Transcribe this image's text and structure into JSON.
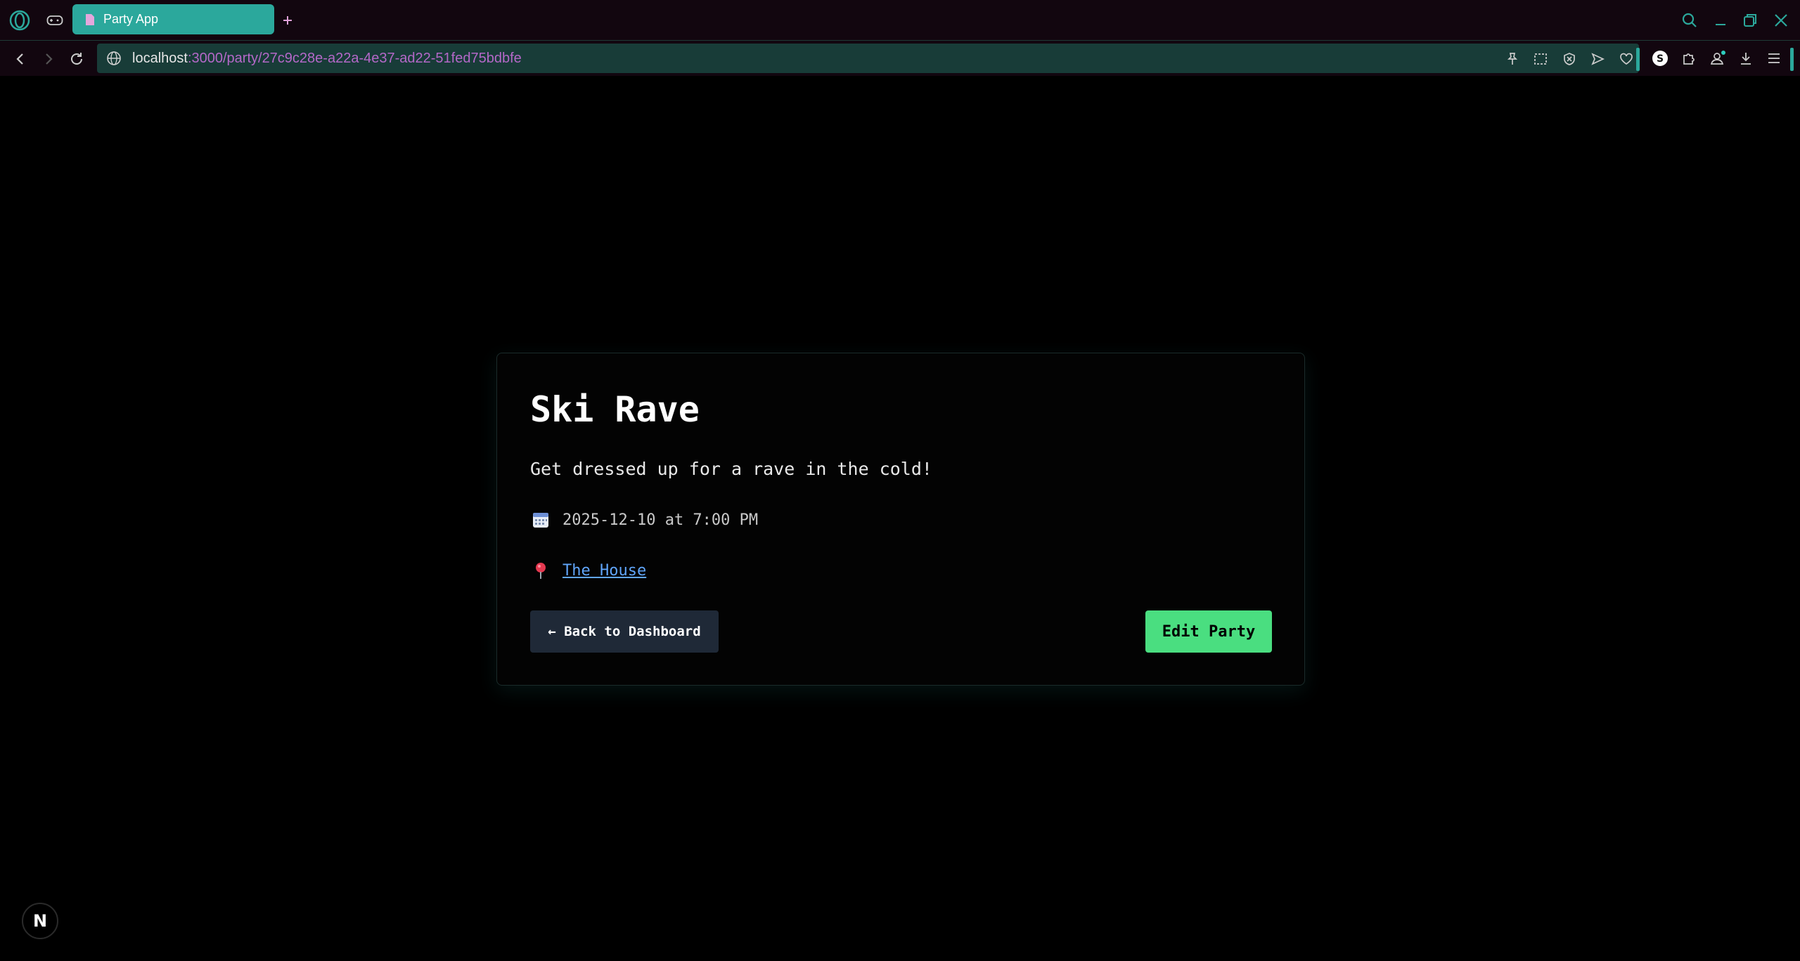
{
  "browser": {
    "tab_title": "Party App",
    "url_host": "localhost",
    "url_path": ":3000/party/27c9c28e-a22a-4e37-ad22-51fed75bdbfe",
    "accent_color": "#2ba89c",
    "path_color": "#b468c8"
  },
  "party": {
    "title": "Ski Rave",
    "description": "Get dressed up for a rave in the cold!",
    "datetime": "2025-12-10 at 7:00 PM",
    "location": "The House"
  },
  "actions": {
    "back_label": "← Back to Dashboard",
    "edit_label": "Edit Party",
    "edit_color": "#4ade80"
  },
  "dev": {
    "badge_letter": "N"
  }
}
